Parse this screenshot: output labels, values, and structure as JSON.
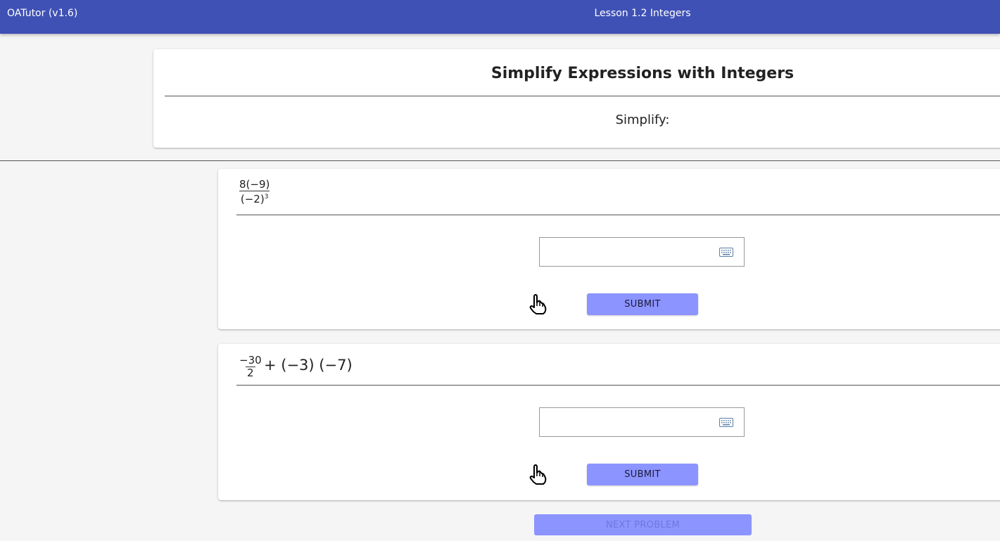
{
  "appbar": {
    "brand": "OATutor (v1.6)",
    "lesson": "Lesson 1.2 Integers"
  },
  "intro": {
    "title": "Simplify Expressions with Integers",
    "subtitle": "Simplify:"
  },
  "steps": [
    {
      "numerator": "8(−9)",
      "denominator_base": "(−2)",
      "denominator_exponent": "3",
      "answer_value": "",
      "submit_label": "SUBMIT"
    },
    {
      "numerator": "−30",
      "denominator": "2",
      "rest": "+ (−3) (−7)",
      "answer_value": "",
      "submit_label": "SUBMIT"
    }
  ],
  "next_label": "NEXT PROBLEM",
  "icons": {
    "keyboard": "keyboard-icon",
    "help": "raised-hand-help-icon"
  },
  "colors": {
    "appbar": "#3f51b5",
    "button": "#8c94ff"
  }
}
